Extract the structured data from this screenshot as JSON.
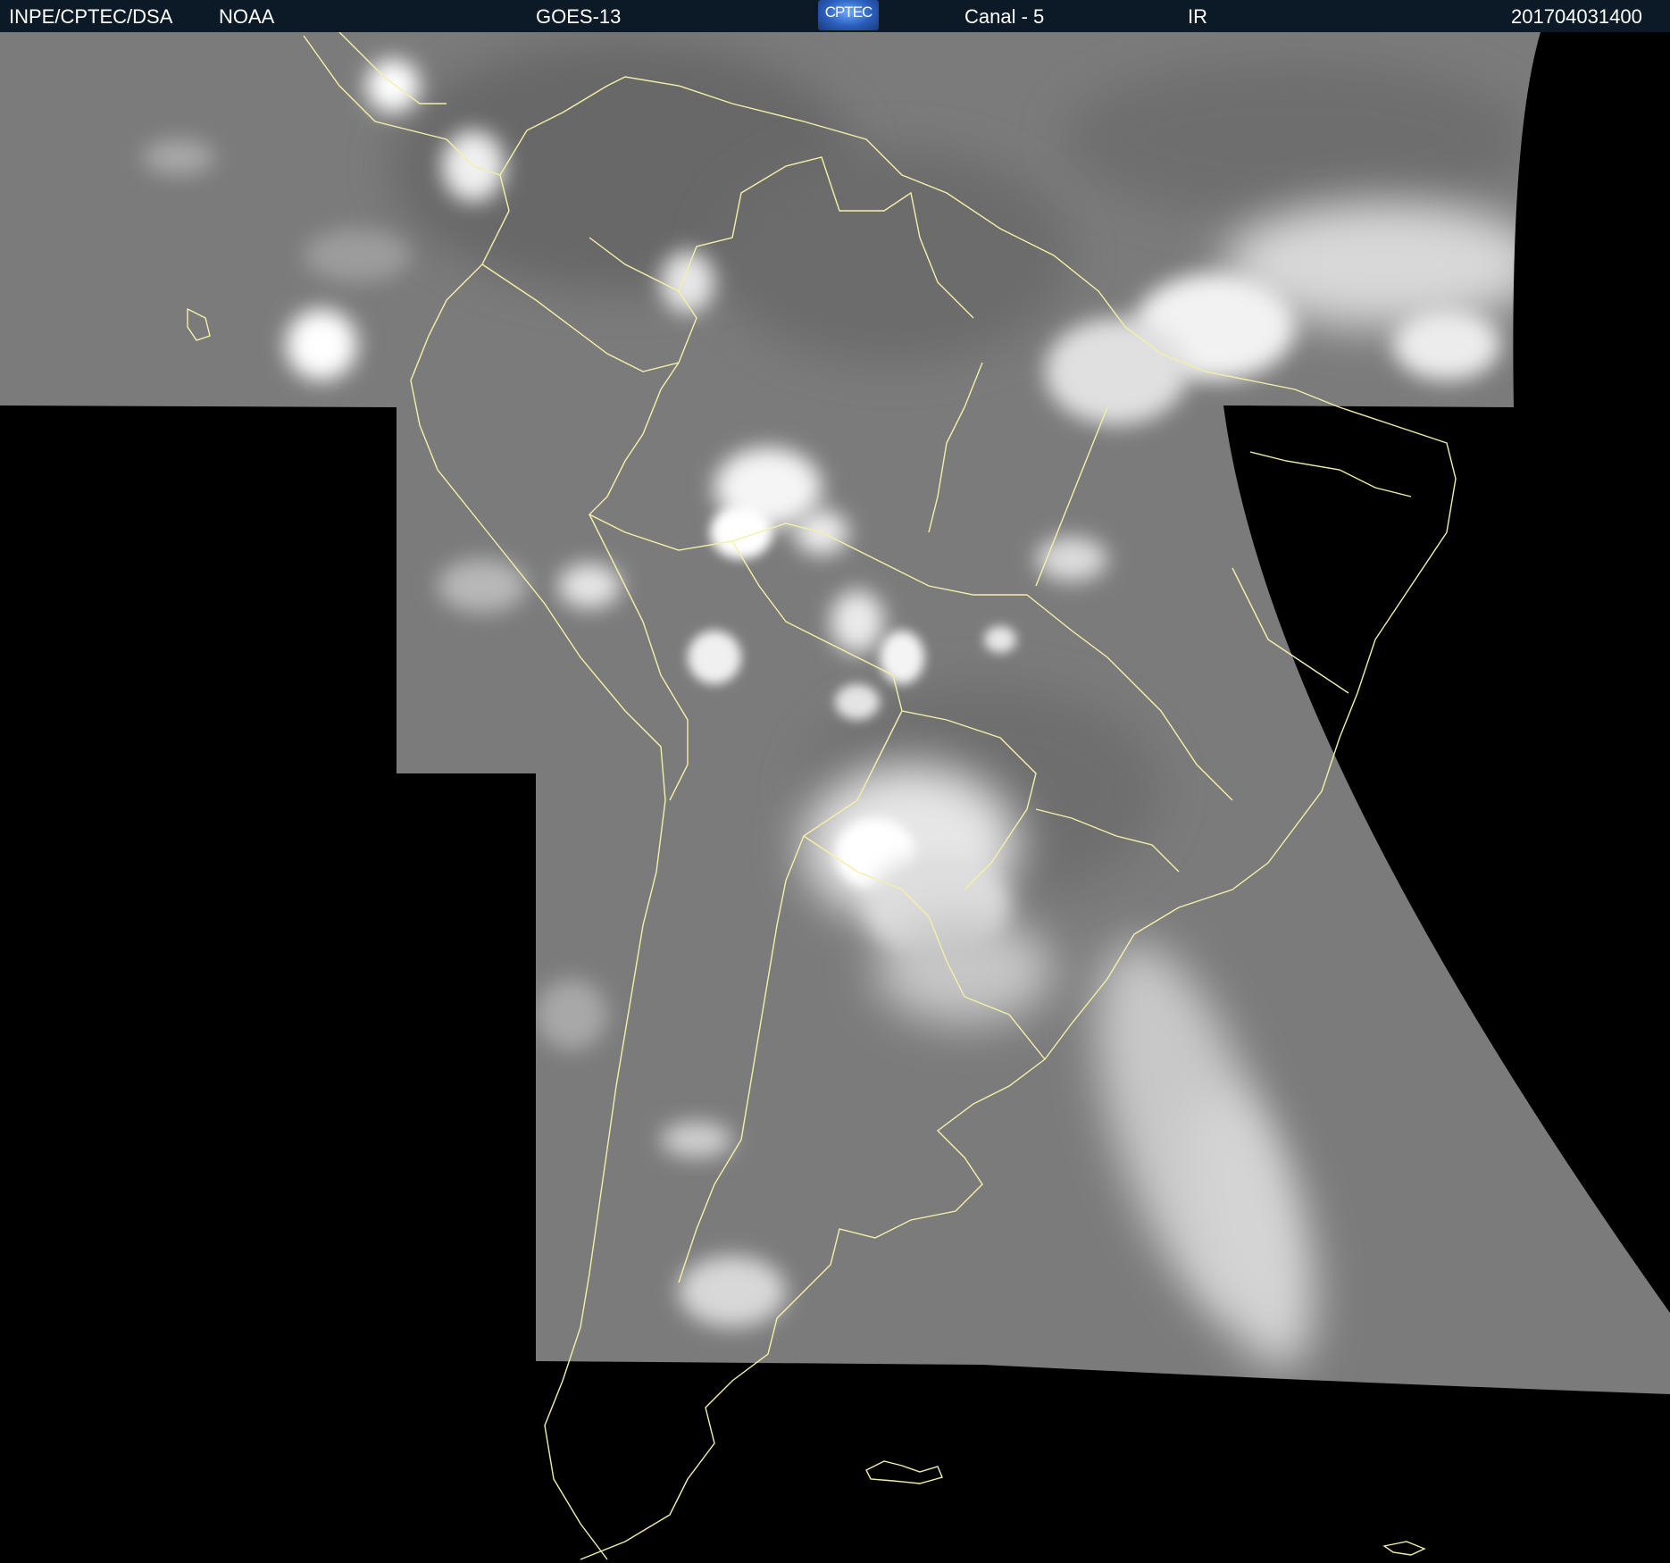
{
  "header": {
    "agency": "INPE/CPTEC/DSA",
    "source": "NOAA",
    "satellite": "GOES-13",
    "logo_text": "CPTEC",
    "channel": "Canal - 5",
    "band": "IR",
    "timestamp": "201704031400"
  },
  "colors": {
    "header_bg": "#0b1a26",
    "background": "#000000",
    "satellite_gray": "#7a7a7a",
    "cloud_white": "#ffffff",
    "coastline": "#f4f0a8"
  }
}
